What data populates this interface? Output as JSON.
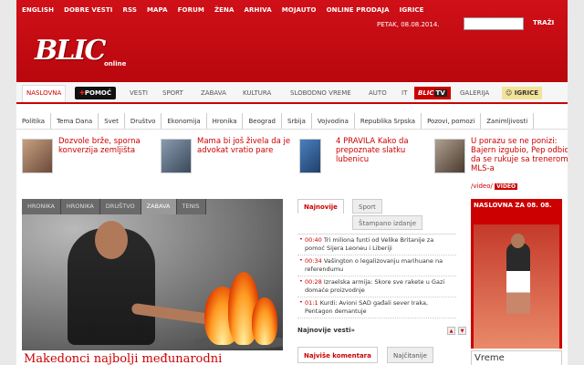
{
  "topnav": [
    "ENGLISH",
    "DOBRE VESTI",
    "RSS",
    "MAPA",
    "FORUM",
    "ŽENA",
    "ARHIVA",
    "MOJAUTO",
    "ONLINE PRODAJA",
    "IGRICE"
  ],
  "header": {
    "logo": "BLIC",
    "online": "online",
    "date": "PETAK, 08.08.2014.",
    "search_button": "TRAŽI",
    "search_value": ""
  },
  "mainnav": {
    "naslovna": "NASLOVNA",
    "pomoc": "POMOĆ",
    "vesti": "VESTI",
    "sport": "SPORT",
    "zabava": "ZABAVA",
    "kultura": "KULTURA",
    "slobodno_vreme": "SLOBODNO VREME",
    "auto": "AUTO",
    "blictv_blic": "BLIC",
    "blictv_tv": "TV",
    "it": "IT",
    "galerija": "GALERIJA",
    "igrice": "IGRICE"
  },
  "subnav": [
    "Politika",
    "Tema Dana",
    "Svet",
    "Društvo",
    "Ekonomija",
    "Hronika",
    "Beograd",
    "Srbija",
    "Vojvodina",
    "Republika Srpska",
    "Pozovi, pomozi",
    "Zanimljivosti"
  ],
  "teasers": [
    {
      "text": "Dozvole brže, sporna konverzija zemljišta"
    },
    {
      "text": "Mama bi još živela da je advokat vratio pare"
    },
    {
      "text": "4 PRAVILA Kako da prepoznate slatku lubenicu"
    },
    {
      "text": "U porazu se ne ponizi: Bajern izgubio, Pep odbio da se rukuje sa trenerom MLS-a",
      "video_link": "/video/",
      "video_badge": "VIDEO"
    }
  ],
  "gallery": {
    "tabs": [
      "HRONIKA",
      "HRONIKA",
      "DRUŠTVO",
      "ZABAVA",
      "TENIS"
    ],
    "active_tab": 3,
    "title": "Makedonci najbolji međunarodni"
  },
  "news": {
    "tabs": {
      "najnovije": "Najnovije",
      "sport": "Sport",
      "stampano": "Štampano izdanje"
    },
    "items": [
      {
        "time": "00:40",
        "text": "Tri miliona funti od Velike Britanije za pomoć Sijera Leoneu i Liberiji"
      },
      {
        "time": "00:34",
        "text": "Vašington o legalizovanju marihuane na referendumu"
      },
      {
        "time": "00:28",
        "text": "Izraelska armija: Skore sve rakete u Gazi domaće proizvodnje"
      },
      {
        "time": "01:1",
        "text": "Kurdi: Avioni SAD gađali sever Iraka, Pentagon demantuje"
      }
    ],
    "more": "Najnovije vesti»",
    "bottom_tabs": {
      "komentari": "Najviše komentara",
      "citanje": "Najčitanije"
    }
  },
  "sidebar": {
    "naslovna_title": "NASLOVNA ZA 08. 08.",
    "vreme": "Vreme"
  },
  "colors": {
    "brand_red": "#c00000"
  }
}
